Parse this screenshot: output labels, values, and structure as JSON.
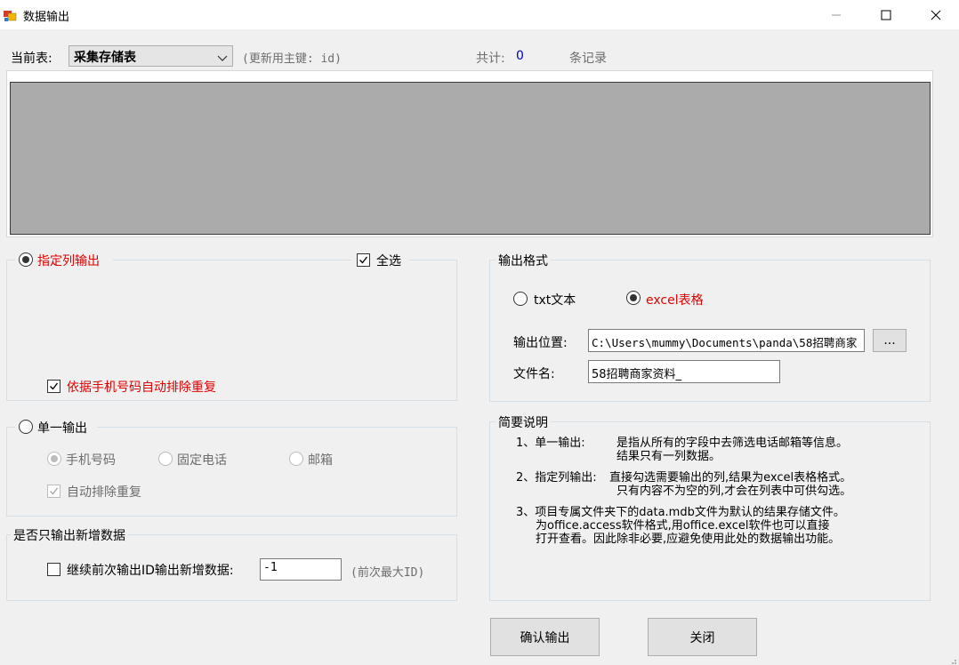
{
  "window": {
    "title": "数据输出",
    "minimize_glyph": "—",
    "maximize_glyph": "☐",
    "close_glyph": "✕"
  },
  "header": {
    "current_table_label": "当前表:",
    "current_table_value": "采集存储表",
    "update_key_note": "(更新用主键: id)",
    "total_label": "共计:",
    "total_value": "0",
    "records_label": "条记录"
  },
  "column_output": {
    "radio_label": "指定列输出",
    "selected": true,
    "select_all_label": "全选",
    "select_all_checked": true,
    "dedupe_label": "依据手机号码自动排除重复",
    "dedupe_checked": true
  },
  "single_output": {
    "radio_label": "单一输出",
    "selected": false,
    "options": [
      "手机号码",
      "固定电话",
      "邮箱"
    ],
    "selected_option": "手机号码",
    "dedupe_label": "自动排除重复",
    "dedupe_checked": true
  },
  "incremental": {
    "group_title": "是否只输出新增数据",
    "continue_label": "继续前次输出ID输出新增数据:",
    "continue_checked": false,
    "id_value": "-1",
    "id_hint": "(前次最大ID)"
  },
  "output_format": {
    "group_title": "输出格式",
    "txt_label": "txt文本",
    "excel_label": "excel表格",
    "selected": "excel",
    "location_label": "输出位置:",
    "location_value": "C:\\Users\\mummy\\Documents\\panda\\58招聘商家",
    "browse_label": "...",
    "filename_label": "文件名:",
    "filename_value": "58招聘商家资料_"
  },
  "notes": {
    "group_title": "简要说明",
    "item1_head": "1、单一输出:",
    "item1_line1": "是指从所有的字段中去筛选电话邮箱等信息。",
    "item1_line2": "结果只有一列数据。",
    "item2_head": "2、指定列输出:",
    "item2_line1": "直接勾选需要输出的列,结果为excel表格格式。",
    "item2_line2": "只有内容不为空的列,才会在列表中可供勾选。",
    "item3_line1": "3、项目专属文件夹下的data.mdb文件为默认的结果存储文件。",
    "item3_line2": "为office.access软件格式,用office.excel软件也可以直接",
    "item3_line3": "打开查看。因此除非必要,应避免使用此处的数据输出功能。"
  },
  "buttons": {
    "confirm_label": "确认输出",
    "close_label": "关闭"
  },
  "colors": {
    "highlight_red": "#e00000",
    "count_blue": "#0000cc",
    "grid_gray": "#ababab"
  }
}
